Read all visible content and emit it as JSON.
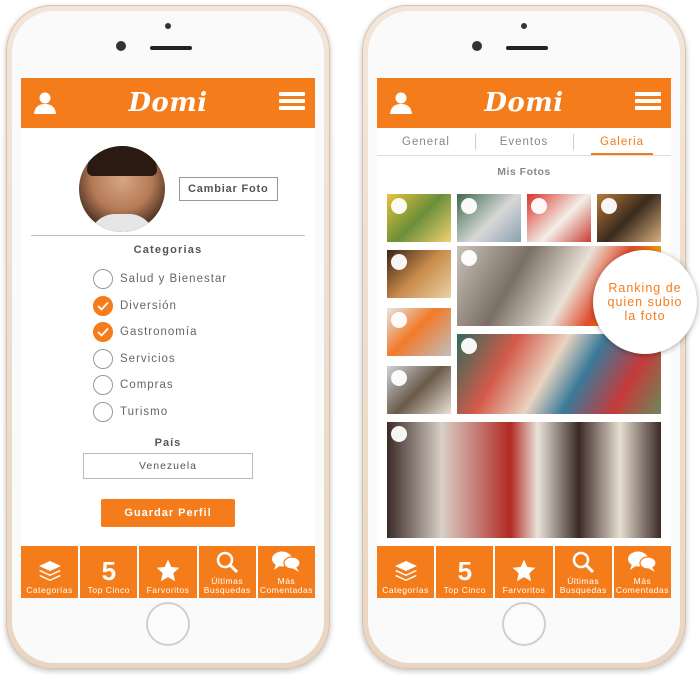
{
  "brand": "Domi",
  "colors": {
    "accent": "#f57c1b",
    "text": "#666666"
  },
  "profile": {
    "change_photo": "Cambiar Foto",
    "categories_title": "Categorias",
    "categories": [
      {
        "label": "Salud y Bienestar",
        "checked": false
      },
      {
        "label": "Diversión",
        "checked": true
      },
      {
        "label": "Gastronomía",
        "checked": true
      },
      {
        "label": "Servicios",
        "checked": false
      },
      {
        "label": "Compras",
        "checked": false
      },
      {
        "label": "Turismo",
        "checked": false
      }
    ],
    "country_label": "País",
    "country_value": "Venezuela",
    "save_label": "Guardar Perfil"
  },
  "gallery": {
    "tabs": [
      "General",
      "Eventos",
      "Galeria"
    ],
    "active_tab": "Galeria",
    "title": "Mis Fotos",
    "ranking_note": "Ranking de quien subio la foto"
  },
  "bottom_nav": [
    {
      "icon": "layers-icon",
      "label": "Categorías",
      "label2": ""
    },
    {
      "icon": "five",
      "number": "5",
      "label": "Top Cinco",
      "label2": ""
    },
    {
      "icon": "star-icon",
      "label": "Farvoritos",
      "label2": ""
    },
    {
      "icon": "search-icon",
      "label": "Últimas",
      "label2": "Busquedas"
    },
    {
      "icon": "chat-bubbles-icon",
      "label": "Más",
      "label2": "Comentadas"
    }
  ]
}
